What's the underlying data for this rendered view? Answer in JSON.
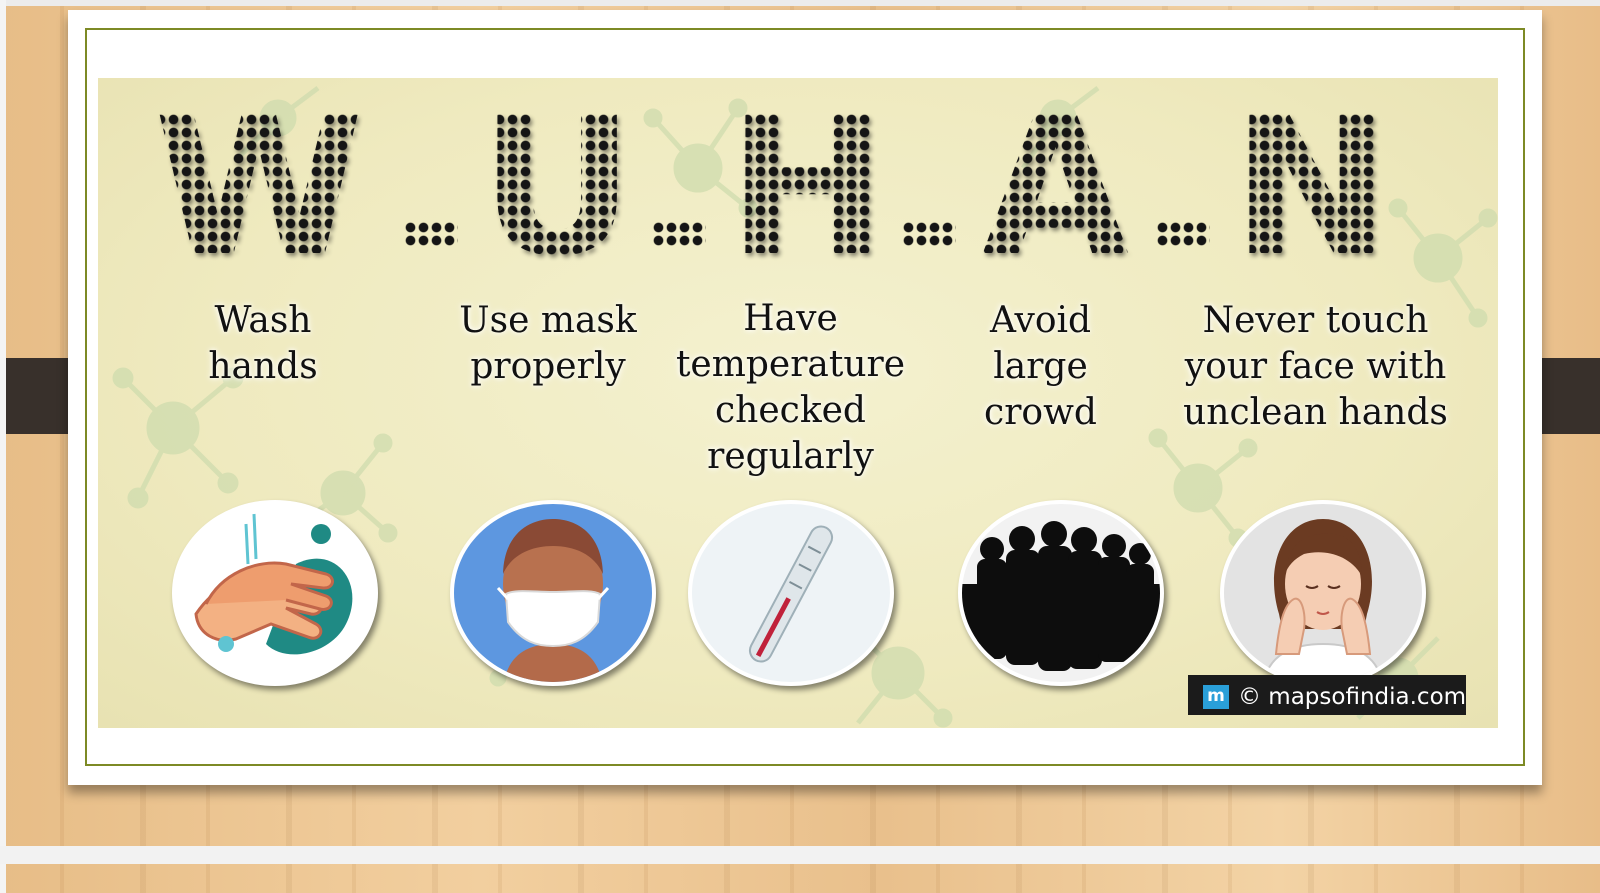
{
  "poster": {
    "title_letters": [
      "W",
      "U",
      "H",
      "A",
      "N"
    ],
    "items": [
      {
        "label": "Wash\nhands",
        "icon": "hand-washing-icon"
      },
      {
        "label": "Use mask\nproperly",
        "icon": "face-mask-icon"
      },
      {
        "label": "Have\ntemperature\nchecked\nregularly",
        "icon": "thermometer-icon"
      },
      {
        "label": "Avoid\nlarge\ncrowd",
        "icon": "crowd-silhouette-icon"
      },
      {
        "label": "Never touch\nyour face with\nunclean hands",
        "icon": "woman-touching-face-icon"
      }
    ]
  },
  "watermark": {
    "logo_letter": "m",
    "text": "© mapsofindia.com"
  },
  "colors": {
    "banner_background": "#efeabf",
    "frame_border": "#7d8a25",
    "dot_letters": "#151515",
    "watermark_background": "#1b1b1b",
    "logo_blue": "#2a9fd8"
  }
}
